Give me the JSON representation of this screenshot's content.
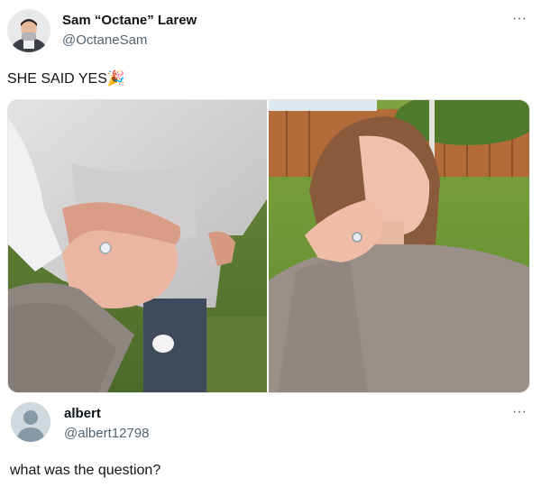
{
  "tweet": {
    "author_name": "Sam “Octane” Larew",
    "author_handle": "@OctaneSam",
    "text": "SHE SAID YES",
    "emoji": "🎉",
    "more_label": "···"
  },
  "reply": {
    "author_name": "albert",
    "author_handle": "@albert12798",
    "text": "what was the question?",
    "more_label": "···"
  },
  "icons": {
    "tweet_avatar": "person-photo-avatar",
    "reply_avatar": "default-user-avatar",
    "more": "more-dots-icon",
    "emoji": "party-popper-icon"
  }
}
